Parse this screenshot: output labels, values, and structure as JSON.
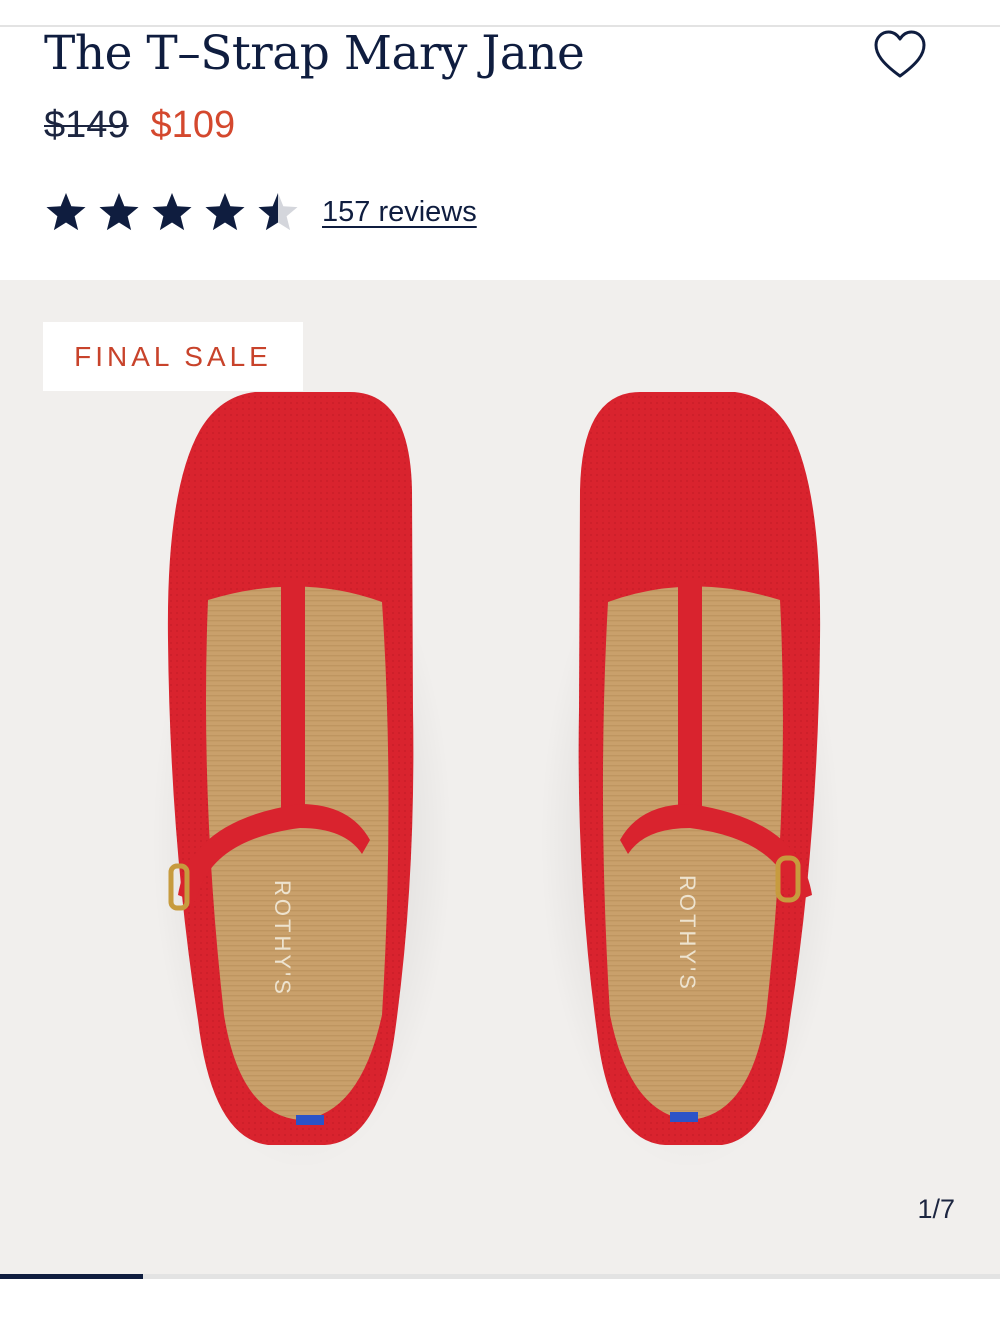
{
  "product": {
    "title": "The T–Strap Mary Jane",
    "price_original": "$149",
    "price_sale": "$109",
    "rating": 4.5,
    "rating_max": 5,
    "reviews_label": "157 reviews",
    "badge": "FINAL SALE",
    "image_counter": "1/7",
    "image_index": 1,
    "image_total": 7,
    "insole_brand": "ROTHY'S"
  },
  "icons": {
    "wishlist": "heart-outline-icon",
    "star": "star-icon"
  },
  "colors": {
    "navy": "#0f1d3f",
    "sale_red": "#d4482e",
    "badge_red": "#c8432b",
    "shoe_red": "#d9232e",
    "gallery_bg": "#f1efed"
  }
}
